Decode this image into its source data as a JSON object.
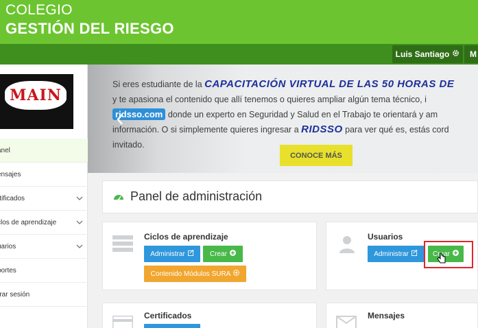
{
  "header": {
    "title_line1": "COLEGIO",
    "title_line2": "GESTIÓN DEL RIESGO",
    "user_label": "Luis Santiago",
    "more_label": "M"
  },
  "sidebar": {
    "logo_text": "MAIN",
    "items": [
      {
        "label": "anel",
        "active": true,
        "has_chevron": false
      },
      {
        "label": "ensajes",
        "active": false,
        "has_chevron": false
      },
      {
        "label": "rtificados",
        "active": false,
        "has_chevron": true
      },
      {
        "label": "clos de aprendizaje",
        "active": false,
        "has_chevron": true
      },
      {
        "label": "uarios",
        "active": false,
        "has_chevron": true
      },
      {
        "label": "portes",
        "active": false,
        "has_chevron": false
      },
      {
        "label": "rrar sesión",
        "active": false,
        "has_chevron": false
      }
    ]
  },
  "banner": {
    "line1_text": "Si eres estudiante de la",
    "line1_highlight": "CAPACITACIÓN VIRTUAL DE LAS 50 HORAS DE",
    "line2_text": "y te apasiona el contenido que allí tenemos o quieres ampliar algún tema técnico, i",
    "line3_pill": "ridsso.com",
    "line3_text": "donde un experto en Seguridad y Salud en el Trabajo te orientará y am",
    "line4_text_a": "información. O si simplemente quieres ingresar a",
    "line4_highlight": "RIDSSO",
    "line4_text_b": "para ver qué es, estás cord",
    "line5_text": "invitado.",
    "cta_label": "CONOCE MÁS"
  },
  "panel": {
    "title": "Panel de administración"
  },
  "cards": {
    "ciclos": {
      "title": "Ciclos de aprendizaje",
      "admin_label": "Administrar",
      "crear_label": "Crear",
      "contenido_label": "Contenido Módulos SURA"
    },
    "usuarios": {
      "title": "Usuarios",
      "admin_label": "Administrar",
      "crear_label": "Crear"
    },
    "certificados": {
      "title": "Certificados"
    },
    "mensajes": {
      "title": "Mensajes"
    }
  },
  "colors": {
    "header_green": "#6cc530",
    "subbar_green": "#3f8f1f",
    "button_blue": "#2f97dc",
    "button_green": "#49b84a",
    "button_orange": "#f1a630",
    "cta_yellow": "#e8e02a",
    "highlight_red": "#e0262b"
  }
}
